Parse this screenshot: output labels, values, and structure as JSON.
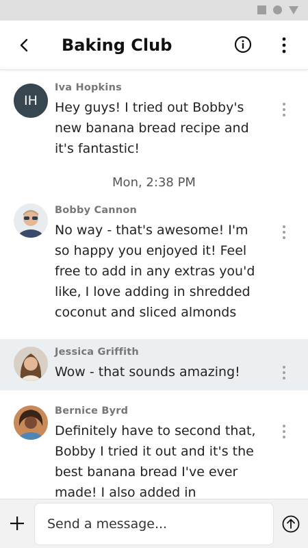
{
  "header": {
    "title": "Baking Club"
  },
  "messages": [
    {
      "author": "Iva Hopkins",
      "initials": "IH",
      "text": "Hey guys! I tried out Bobby's new banana bread recipe and it's fantastic!",
      "avatar": "initials"
    },
    {
      "author": "Bobby Cannon",
      "text": "No way - that's awesome! I'm so happy you enjoyed it! Feel free to add in any extras you'd like, I love adding in shredded coconut and sliced almonds",
      "avatar": "photo"
    },
    {
      "author": "Jessica Griffith",
      "text": "Wow - that sounds amazing!",
      "avatar": "photo"
    },
    {
      "author": "Bernice Byrd",
      "text": "Definitely have to second that, Bobby I tried it out and it's the best banana bread I've ever made! I also added in chococlate",
      "avatar": "photo"
    }
  ],
  "timestamp": "Mon, 2:38 PM",
  "composer": {
    "placeholder": "Send a message..."
  },
  "icons": {
    "back": "arrow-left-icon",
    "info": "info-circle-icon",
    "more": "more-vertical-icon",
    "add": "plus-icon",
    "send": "arrow-up-circle-icon"
  },
  "colors": {
    "initials_avatar": "#37474f",
    "highlight_row": "#eceff1",
    "status_bar": "#e0e0e0"
  }
}
